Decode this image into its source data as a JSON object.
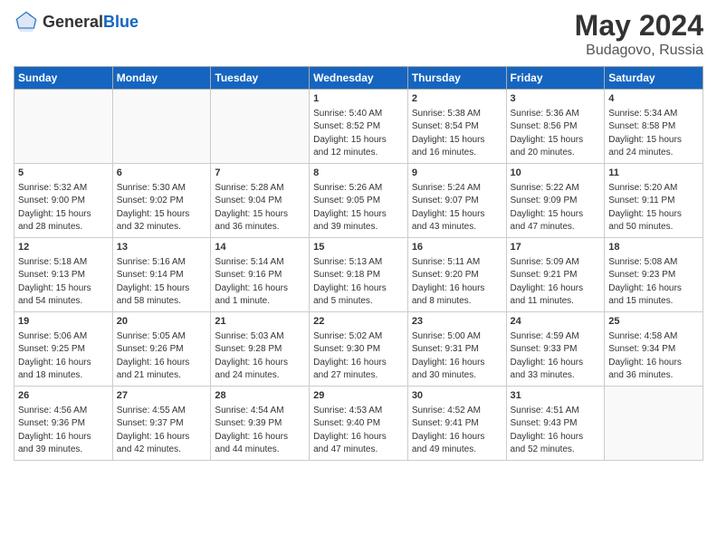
{
  "header": {
    "logo_general": "General",
    "logo_blue": "Blue",
    "title": "May 2024",
    "location": "Budagovo, Russia"
  },
  "days_of_week": [
    "Sunday",
    "Monday",
    "Tuesday",
    "Wednesday",
    "Thursday",
    "Friday",
    "Saturday"
  ],
  "weeks": [
    {
      "shaded": false,
      "days": [
        {
          "num": "",
          "info": ""
        },
        {
          "num": "",
          "info": ""
        },
        {
          "num": "",
          "info": ""
        },
        {
          "num": "1",
          "info": "Sunrise: 5:40 AM\nSunset: 8:52 PM\nDaylight: 15 hours\nand 12 minutes."
        },
        {
          "num": "2",
          "info": "Sunrise: 5:38 AM\nSunset: 8:54 PM\nDaylight: 15 hours\nand 16 minutes."
        },
        {
          "num": "3",
          "info": "Sunrise: 5:36 AM\nSunset: 8:56 PM\nDaylight: 15 hours\nand 20 minutes."
        },
        {
          "num": "4",
          "info": "Sunrise: 5:34 AM\nSunset: 8:58 PM\nDaylight: 15 hours\nand 24 minutes."
        }
      ]
    },
    {
      "shaded": true,
      "days": [
        {
          "num": "5",
          "info": "Sunrise: 5:32 AM\nSunset: 9:00 PM\nDaylight: 15 hours\nand 28 minutes."
        },
        {
          "num": "6",
          "info": "Sunrise: 5:30 AM\nSunset: 9:02 PM\nDaylight: 15 hours\nand 32 minutes."
        },
        {
          "num": "7",
          "info": "Sunrise: 5:28 AM\nSunset: 9:04 PM\nDaylight: 15 hours\nand 36 minutes."
        },
        {
          "num": "8",
          "info": "Sunrise: 5:26 AM\nSunset: 9:05 PM\nDaylight: 15 hours\nand 39 minutes."
        },
        {
          "num": "9",
          "info": "Sunrise: 5:24 AM\nSunset: 9:07 PM\nDaylight: 15 hours\nand 43 minutes."
        },
        {
          "num": "10",
          "info": "Sunrise: 5:22 AM\nSunset: 9:09 PM\nDaylight: 15 hours\nand 47 minutes."
        },
        {
          "num": "11",
          "info": "Sunrise: 5:20 AM\nSunset: 9:11 PM\nDaylight: 15 hours\nand 50 minutes."
        }
      ]
    },
    {
      "shaded": false,
      "days": [
        {
          "num": "12",
          "info": "Sunrise: 5:18 AM\nSunset: 9:13 PM\nDaylight: 15 hours\nand 54 minutes."
        },
        {
          "num": "13",
          "info": "Sunrise: 5:16 AM\nSunset: 9:14 PM\nDaylight: 15 hours\nand 58 minutes."
        },
        {
          "num": "14",
          "info": "Sunrise: 5:14 AM\nSunset: 9:16 PM\nDaylight: 16 hours\nand 1 minute."
        },
        {
          "num": "15",
          "info": "Sunrise: 5:13 AM\nSunset: 9:18 PM\nDaylight: 16 hours\nand 5 minutes."
        },
        {
          "num": "16",
          "info": "Sunrise: 5:11 AM\nSunset: 9:20 PM\nDaylight: 16 hours\nand 8 minutes."
        },
        {
          "num": "17",
          "info": "Sunrise: 5:09 AM\nSunset: 9:21 PM\nDaylight: 16 hours\nand 11 minutes."
        },
        {
          "num": "18",
          "info": "Sunrise: 5:08 AM\nSunset: 9:23 PM\nDaylight: 16 hours\nand 15 minutes."
        }
      ]
    },
    {
      "shaded": true,
      "days": [
        {
          "num": "19",
          "info": "Sunrise: 5:06 AM\nSunset: 9:25 PM\nDaylight: 16 hours\nand 18 minutes."
        },
        {
          "num": "20",
          "info": "Sunrise: 5:05 AM\nSunset: 9:26 PM\nDaylight: 16 hours\nand 21 minutes."
        },
        {
          "num": "21",
          "info": "Sunrise: 5:03 AM\nSunset: 9:28 PM\nDaylight: 16 hours\nand 24 minutes."
        },
        {
          "num": "22",
          "info": "Sunrise: 5:02 AM\nSunset: 9:30 PM\nDaylight: 16 hours\nand 27 minutes."
        },
        {
          "num": "23",
          "info": "Sunrise: 5:00 AM\nSunset: 9:31 PM\nDaylight: 16 hours\nand 30 minutes."
        },
        {
          "num": "24",
          "info": "Sunrise: 4:59 AM\nSunset: 9:33 PM\nDaylight: 16 hours\nand 33 minutes."
        },
        {
          "num": "25",
          "info": "Sunrise: 4:58 AM\nSunset: 9:34 PM\nDaylight: 16 hours\nand 36 minutes."
        }
      ]
    },
    {
      "shaded": false,
      "days": [
        {
          "num": "26",
          "info": "Sunrise: 4:56 AM\nSunset: 9:36 PM\nDaylight: 16 hours\nand 39 minutes."
        },
        {
          "num": "27",
          "info": "Sunrise: 4:55 AM\nSunset: 9:37 PM\nDaylight: 16 hours\nand 42 minutes."
        },
        {
          "num": "28",
          "info": "Sunrise: 4:54 AM\nSunset: 9:39 PM\nDaylight: 16 hours\nand 44 minutes."
        },
        {
          "num": "29",
          "info": "Sunrise: 4:53 AM\nSunset: 9:40 PM\nDaylight: 16 hours\nand 47 minutes."
        },
        {
          "num": "30",
          "info": "Sunrise: 4:52 AM\nSunset: 9:41 PM\nDaylight: 16 hours\nand 49 minutes."
        },
        {
          "num": "31",
          "info": "Sunrise: 4:51 AM\nSunset: 9:43 PM\nDaylight: 16 hours\nand 52 minutes."
        },
        {
          "num": "",
          "info": ""
        }
      ]
    }
  ]
}
